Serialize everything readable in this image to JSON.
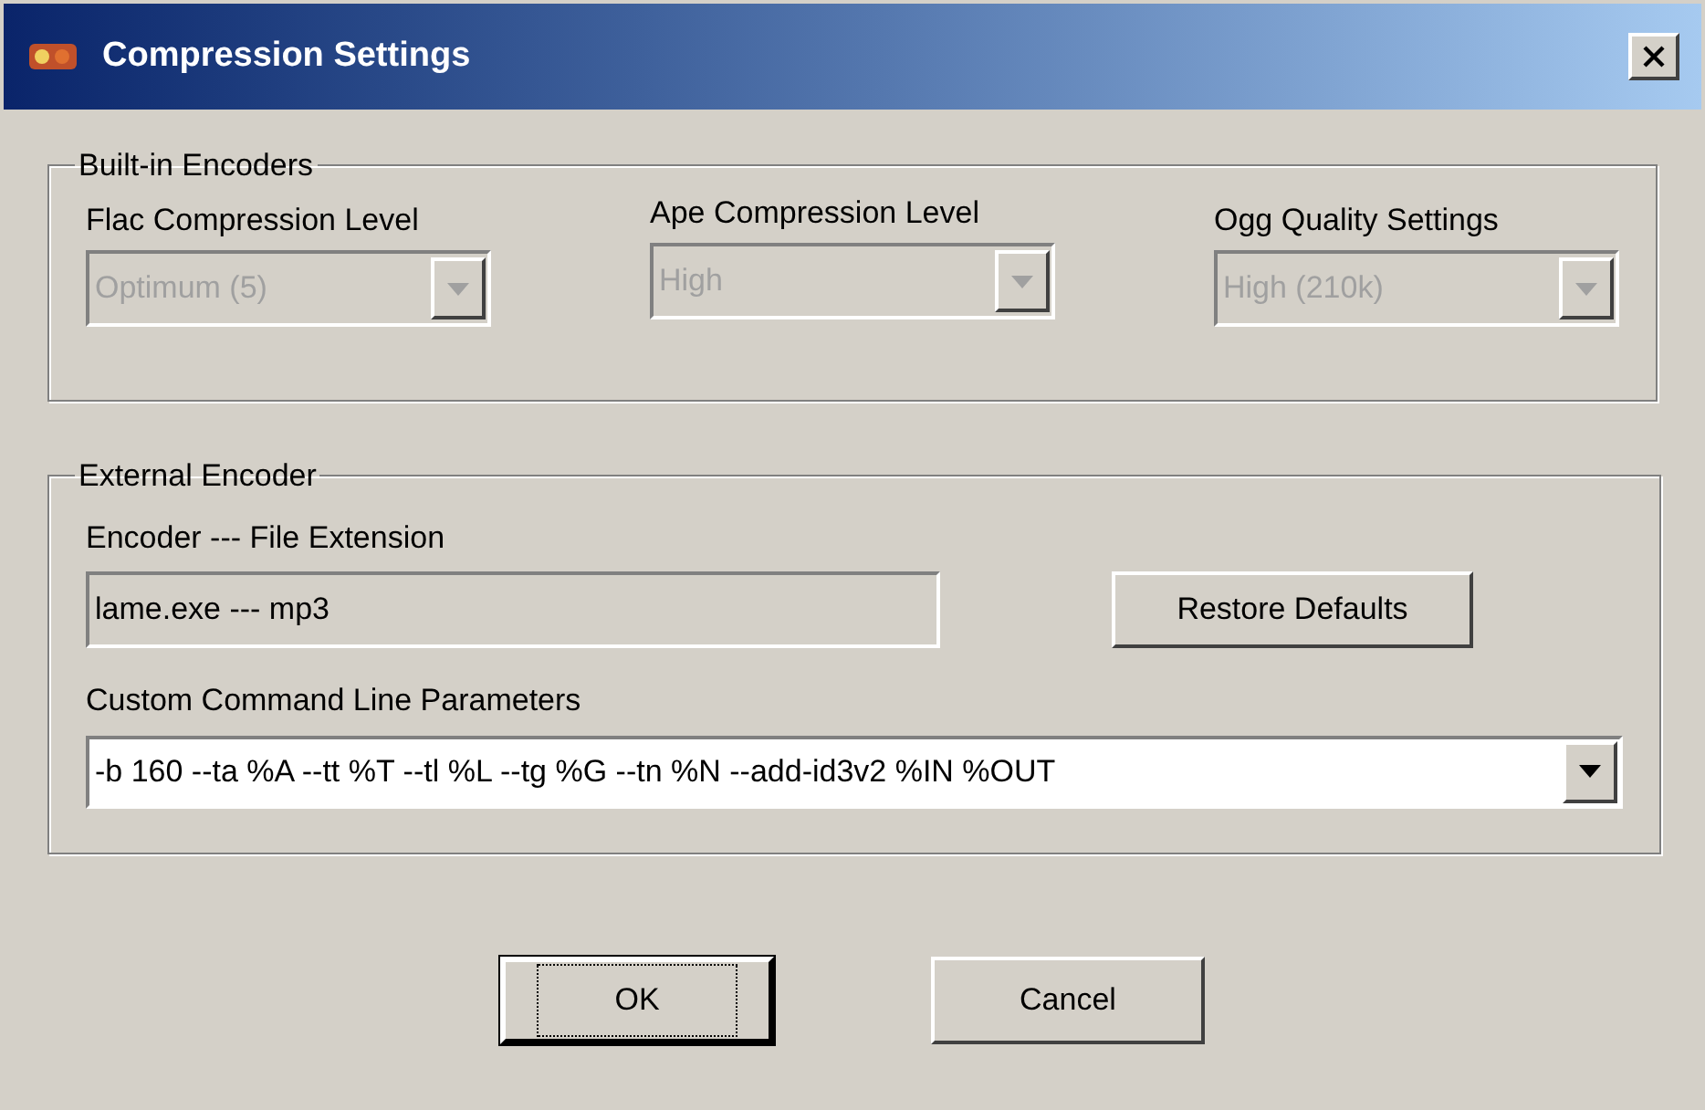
{
  "window": {
    "title": "Compression Settings"
  },
  "builtin_encoders": {
    "label": "Built-in Encoders",
    "selects": [
      {
        "label": "Flac Compression Level",
        "value": "Optimum (5)",
        "disabled": true
      },
      {
        "label": "Ape Compression Level",
        "value": "High",
        "disabled": true
      },
      {
        "label": "Ogg Quality Settings",
        "value": "High (210k)",
        "disabled": true
      }
    ]
  },
  "external_encoder": {
    "label": "External Encoder",
    "file_extension": {
      "label": "Encoder --- File Extension",
      "value": "lame.exe --- mp3"
    },
    "restore_button": "Restore Defaults",
    "parameters": {
      "label": "Custom Command Line Parameters",
      "value": "-b 160 --ta %A --tt %T --tl %L --tg %G --tn %N --add-id3v2 %IN %OUT",
      "disabled": false
    }
  },
  "buttons": [
    {
      "label": "OK",
      "focused": true
    },
    {
      "label": "Cancel",
      "focused": false
    }
  ]
}
